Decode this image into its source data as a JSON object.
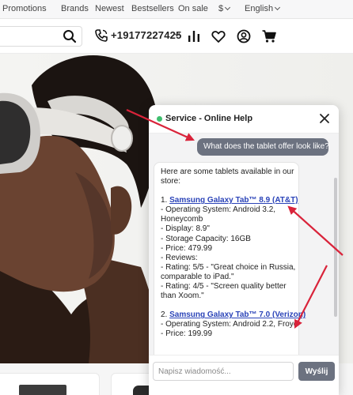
{
  "topnav": {
    "items": [
      "Promotions",
      "Brands",
      "Newest",
      "Bestsellers",
      "On sale"
    ],
    "currency": "$",
    "language": "English"
  },
  "header": {
    "phone": "+19177227425",
    "icons": [
      "search-icon",
      "phone-icon",
      "chevron-down-icon",
      "stats-icon",
      "heart-icon",
      "account-icon",
      "cart-icon"
    ]
  },
  "chat": {
    "title": "Service - Online Help",
    "status_color": "#3fbf6f",
    "user_message": "What does the tablet offer look like?",
    "bot_message": {
      "intro1": "Here are some tablets available in our",
      "intro2": "store:",
      "p1_num": "1. ",
      "p1_link": "Samsung Galaxy Tab™ 8.9 (AT&T)",
      "p1_os1": "- Operating System: Android 3.2,",
      "p1_os2": "Honeycomb",
      "p1_display": "- Display: 8.9\"",
      "p1_storage": "- Storage Capacity: 16GB",
      "p1_price": "- Price: 479.99",
      "p1_reviews": "- Reviews:",
      "p1_r1a": "- Rating: 5/5 - \"Great choice in Russia,",
      "p1_r1b": "comparable to iPad.\"",
      "p1_r2a": "- Rating: 4/5 - \"Screen quality better",
      "p1_r2b": "than Xoom.\"",
      "p2_num": "2. ",
      "p2_link": "Samsung Galaxy Tab™ 7.0 (Verizon)",
      "p2_os": "- Operating System: Android 2.2, Froyo",
      "p2_price": "- Price: 199.99"
    },
    "input_placeholder": "Napisz wiadomość...",
    "send_label": "Wyślij"
  },
  "colors": {
    "accent_gray": "#6c7280",
    "link_blue": "#2a43b8",
    "annotation_red": "#d9233a"
  }
}
